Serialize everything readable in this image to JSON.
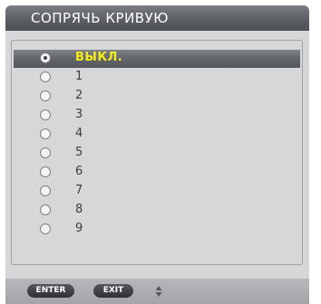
{
  "title": "СОПРЯЧЬ КРИВУЮ",
  "options": [
    {
      "label": "ВЫКЛ.",
      "selected": true
    },
    {
      "label": "1",
      "selected": false
    },
    {
      "label": "2",
      "selected": false
    },
    {
      "label": "3",
      "selected": false
    },
    {
      "label": "4",
      "selected": false
    },
    {
      "label": "5",
      "selected": false
    },
    {
      "label": "6",
      "selected": false
    },
    {
      "label": "7",
      "selected": false
    },
    {
      "label": "8",
      "selected": false
    },
    {
      "label": "9",
      "selected": false
    }
  ],
  "footer": {
    "enter_label": "ENTER",
    "exit_label": "EXIT",
    "updown_icon": "up-down-arrow-icon"
  },
  "colors": {
    "selected_text": "#f5ec1c",
    "panel_bg": "#d6d7d9",
    "title_bg": "#5c5f64"
  }
}
